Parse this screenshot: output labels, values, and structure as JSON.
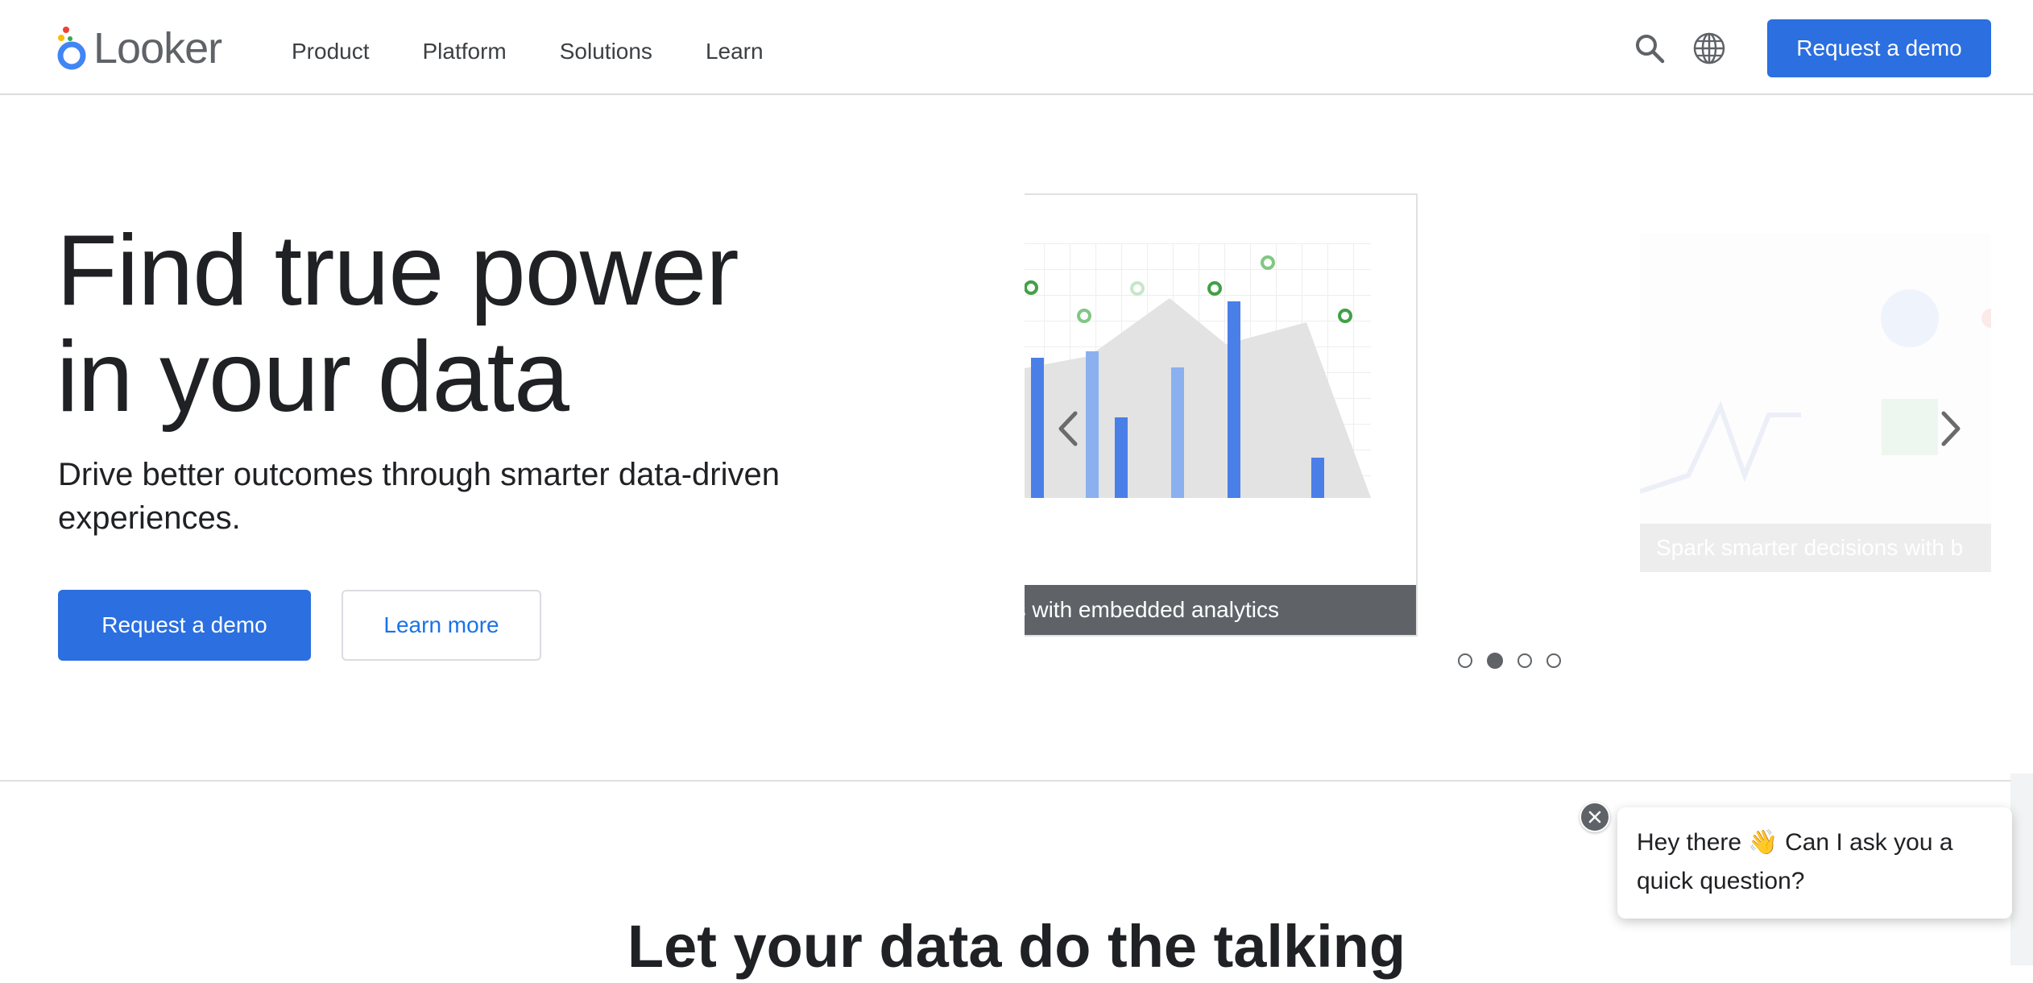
{
  "header": {
    "logo_text": "Looker",
    "nav": [
      "Product",
      "Platform",
      "Solutions",
      "Learn"
    ],
    "cta_label": "Request a demo",
    "icons": [
      "search-icon",
      "globe-icon"
    ]
  },
  "hero": {
    "title_line1": "Find true power",
    "title_line2": "in your data",
    "subtitle": "Drive better outcomes through smarter data-driven experiences.",
    "primary_button": "Request a demo",
    "secondary_button": "Learn more"
  },
  "carousel": {
    "active_caption": "es with embedded analytics",
    "next_caption": "Spark smarter decisions with b",
    "dot_count": 4,
    "active_dot_index": 1,
    "colors": {
      "bar_dark": "#4a7fe8",
      "bar_light": "#8ab0f0",
      "area": "#e3e3e3",
      "marker": "#4caf50"
    }
  },
  "section": {
    "title": "Let your data do the talking"
  },
  "chat": {
    "message": "Hey there 👋  Can I ask you a quick question?"
  },
  "colors": {
    "primary": "#2b6fe0",
    "text": "#202124",
    "muted": "#5f6368"
  }
}
